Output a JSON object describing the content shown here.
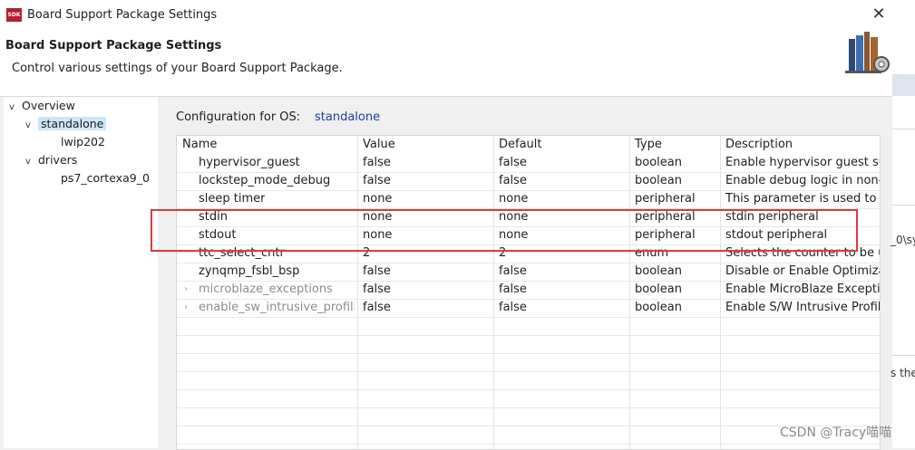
{
  "window": {
    "icon_text": "SDK",
    "title": "Board Support Package Settings"
  },
  "header": {
    "title": "Board Support Package Settings",
    "subtitle": "Control various settings of your Board Support Package."
  },
  "tree": [
    {
      "label": "Overview",
      "twisty": "v"
    },
    {
      "label": "standalone",
      "twisty": "v"
    },
    {
      "label": "lwip202",
      "twisty": ""
    },
    {
      "label": "drivers",
      "twisty": "v"
    },
    {
      "label": "ps7_cortexa9_0",
      "twisty": ""
    }
  ],
  "config": {
    "label": "Configuration for OS:",
    "value": "standalone"
  },
  "table": {
    "headers": [
      "Name",
      "Value",
      "Default",
      "Type",
      "Description"
    ],
    "rows": [
      {
        "name": "hypervisor_guest",
        "value": "false",
        "default": "false",
        "type": "boolean",
        "description": "Enable hypervisor guest supp"
      },
      {
        "name": "lockstep_mode_debug",
        "value": "false",
        "default": "false",
        "type": "boolean",
        "description": "Enable debug logic in non-JT"
      },
      {
        "name": "sleep timer",
        "value": "none",
        "default": "none",
        "type": "peripheral",
        "description": "This parameter is used to sel"
      },
      {
        "name": "stdin",
        "value": "none",
        "default": "none",
        "type": "peripheral",
        "description": "stdin peripheral"
      },
      {
        "name": "stdout",
        "value": "none",
        "default": "none",
        "type": "peripheral",
        "description": "stdout peripheral"
      },
      {
        "name": "ttc_select_cntr",
        "value": "2",
        "default": "2",
        "type": "enum",
        "description": "Selects the counter to be use"
      },
      {
        "name": "zynqmp_fsbl_bsp",
        "value": "false",
        "default": "false",
        "type": "boolean",
        "description": "Disable or Enable Optimizatio"
      },
      {
        "name": "microblaze_exceptions",
        "value": "false",
        "default": "false",
        "type": "boolean",
        "description": "Enable MicroBlaze Exceptions"
      },
      {
        "name": "enable_sw_intrusive_profiling",
        "value": "false",
        "default": "false",
        "type": "boolean",
        "description": "Enable S/W Intrusive Profiling"
      }
    ]
  },
  "background_text": {
    "line1": "_0\\sy",
    "line2": "s the"
  },
  "watermark": "CSDN @Tracy喵喵",
  "colors": {
    "highlight_border": "#e0383a",
    "selection": "#cde6f7",
    "link_blue": "#1a3fa8"
  }
}
